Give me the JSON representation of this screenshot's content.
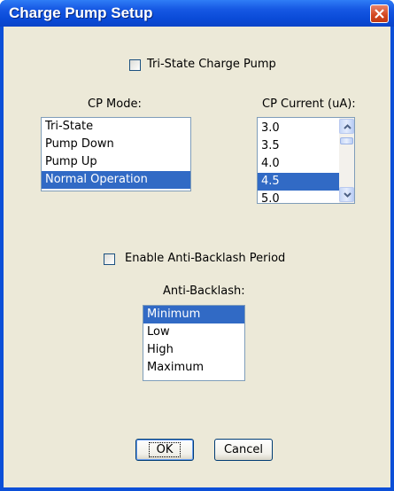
{
  "window": {
    "title": "Charge Pump Setup"
  },
  "tristate_checkbox": {
    "label": "Tri-State Charge Pump",
    "checked": false
  },
  "cp_mode": {
    "label": "CP Mode:",
    "items": [
      "Tri-State",
      "Pump Down",
      "Pump Up",
      "Normal Operation"
    ],
    "selected": "Normal Operation"
  },
  "cp_current": {
    "label": "CP Current (uA):",
    "items": [
      "3.0",
      "3.5",
      "4.0",
      "4.5",
      "5.0"
    ],
    "selected": "4.5"
  },
  "antibacklash_checkbox": {
    "label": "Enable Anti-Backlash Period",
    "checked": false
  },
  "anti_backlash": {
    "label": "Anti-Backlash:",
    "items": [
      "Minimum",
      "Low",
      "High",
      "Maximum"
    ],
    "selected": "Minimum"
  },
  "buttons": {
    "ok": "OK",
    "cancel": "Cancel"
  },
  "colors": {
    "titlebar": "#0a4bd8",
    "client": "#ece9d8",
    "selection": "#316ac5"
  }
}
